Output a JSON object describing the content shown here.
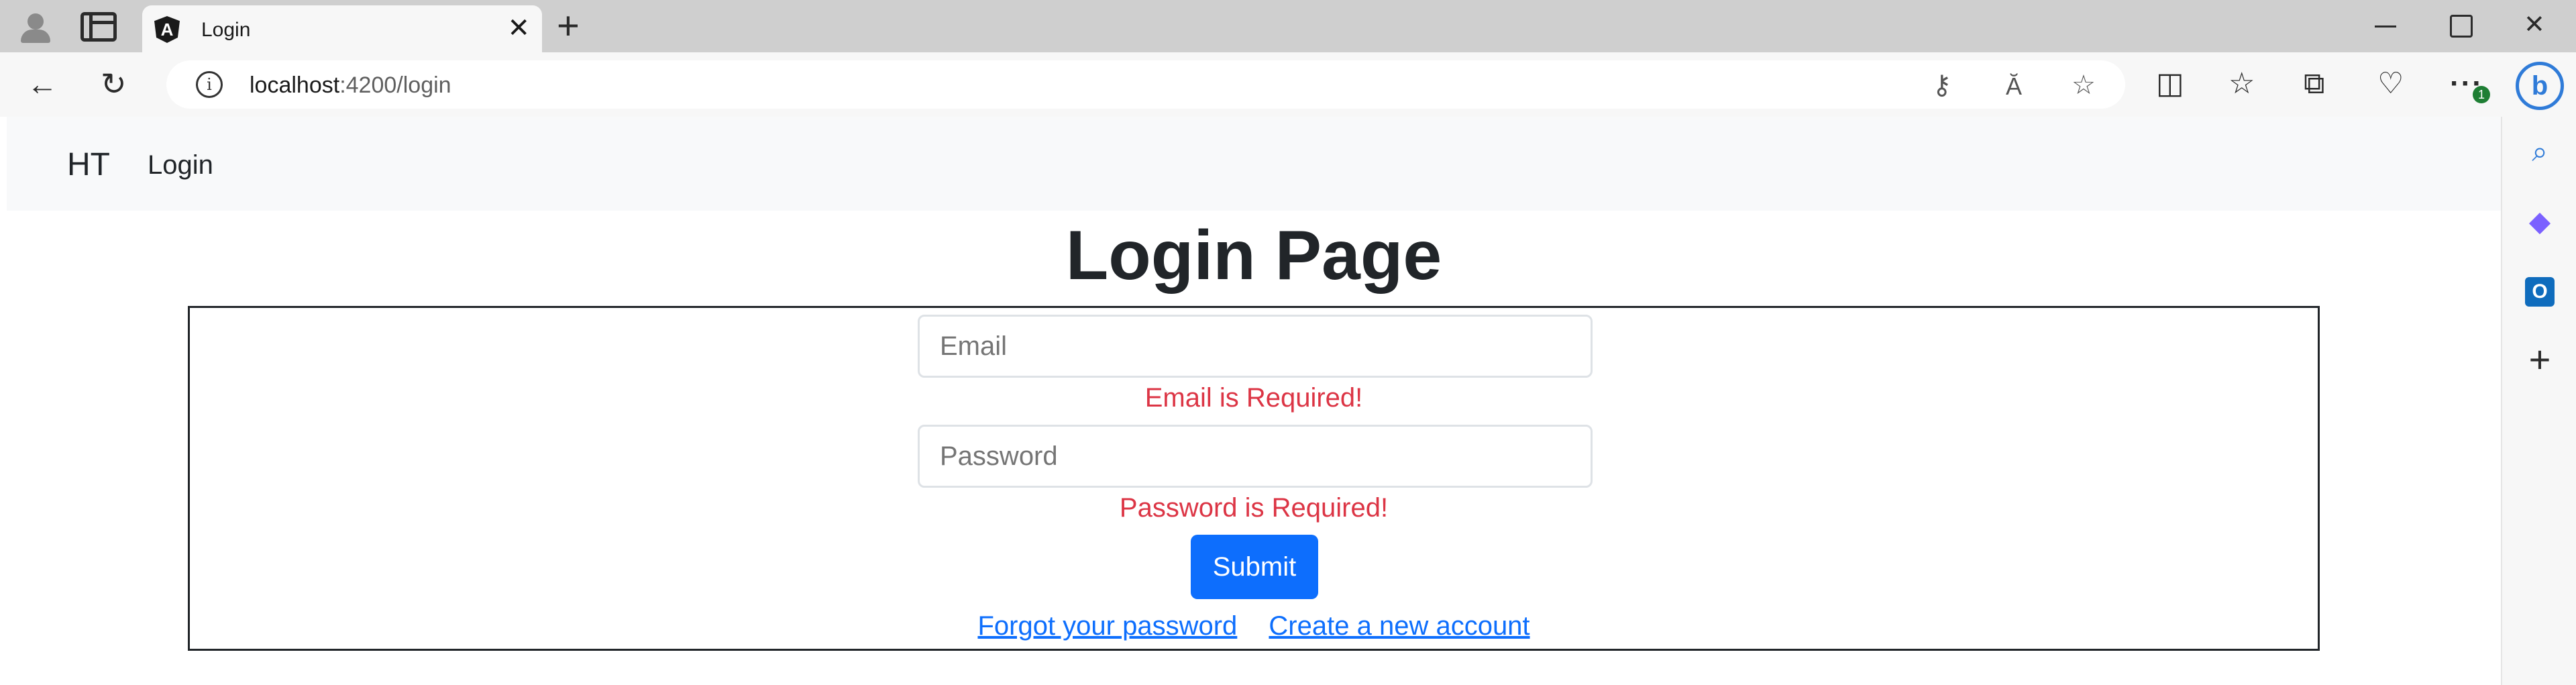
{
  "browser": {
    "tab": {
      "title": "Login",
      "logo_glyph": "A",
      "close_glyph": "✕"
    },
    "new_tab_glyph": "+",
    "window": {
      "close_glyph": "✕"
    },
    "address": {
      "host": "localhost",
      "path": ":4200/login",
      "info_glyph": "i"
    },
    "badge_count": "1",
    "bing_glyph": "b",
    "icons": {
      "back": "←",
      "refresh": "↻",
      "key": "⚷",
      "read_aloud": "Ă",
      "favorite": "☆",
      "split_screen": "◫",
      "favorites": "☆",
      "collections": "⧉",
      "health": "♡",
      "more": "···"
    },
    "sidebar": {
      "search": "⌕",
      "copilot": "◆",
      "outlook": "O",
      "add": "+"
    }
  },
  "navbar": {
    "brand": "HT",
    "login_link": "Login"
  },
  "main": {
    "title": "Login Page",
    "email_placeholder": "Email",
    "email_error": "Email is Required!",
    "password_placeholder": "Password",
    "password_error": "Password is Required!",
    "submit_label": "Submit",
    "forgot_link": "Forgot your password",
    "create_link": "Create a new account"
  },
  "colors": {
    "primary": "#0d6efd",
    "error": "#dc3545",
    "text": "#212529",
    "navbar_bg": "#f8f9fa"
  }
}
